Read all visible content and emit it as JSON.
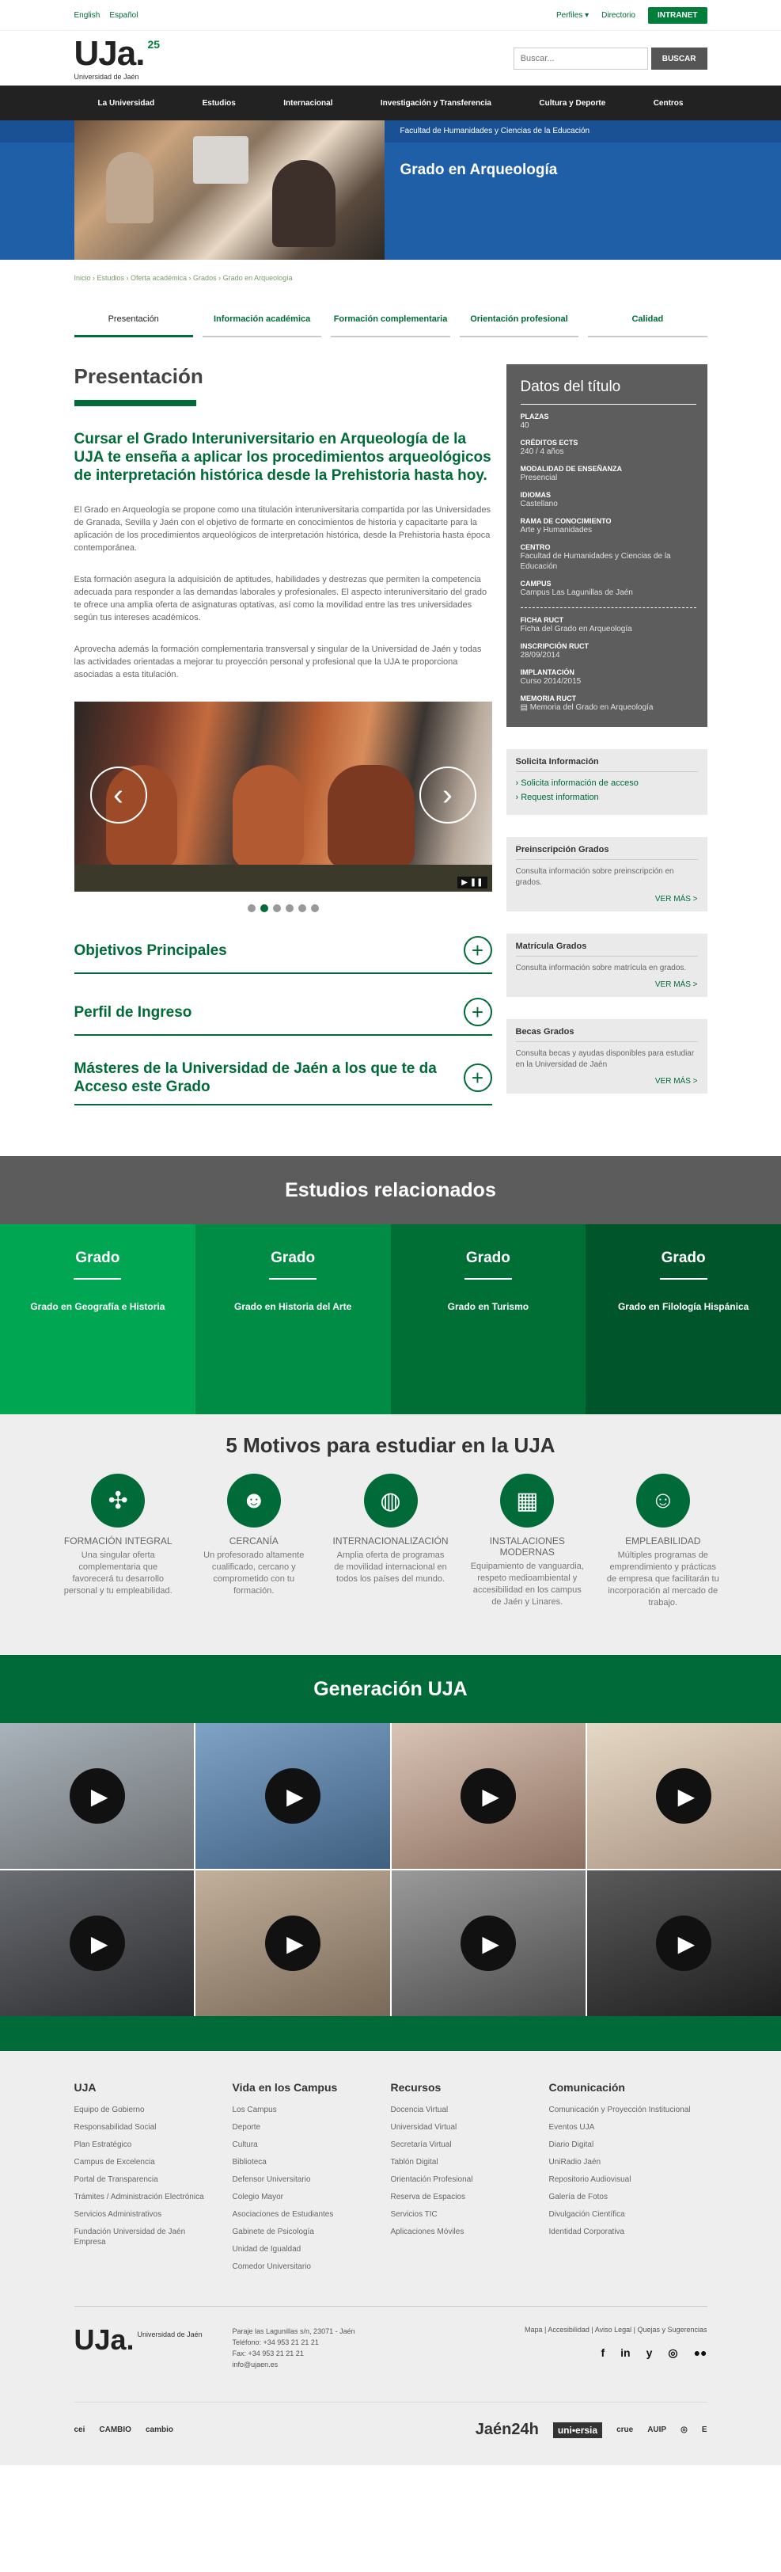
{
  "topbar": {
    "languages": [
      "English",
      "Español"
    ],
    "perfiles": "Perfiles",
    "directorio": "Directorio",
    "intranet": "INTRANET"
  },
  "header": {
    "logo_text": "UJa.",
    "logo_subtitle": "Universidad de Jaén",
    "logo_anniv": "25",
    "search_placeholder": "Buscar...",
    "search_button": "BUSCAR"
  },
  "nav": [
    "La Universidad",
    "Estudios",
    "Internacional",
    "Investigación y Transferencia",
    "Cultura y Deporte",
    "Centros"
  ],
  "hero": {
    "faculty": "Facultad de Humanidades y Ciencias de la Educación",
    "title": "Grado en Arqueología"
  },
  "breadcrumb": "Inicio › Estudios › Oferta académica › Grados › Grado en Arqueología",
  "tabs": [
    "Presentación",
    "Información académica",
    "Formación complementaria",
    "Orientación profesional",
    "Calidad"
  ],
  "content": {
    "heading": "Presentación",
    "lead": "Cursar el Grado Interuniversitario en Arqueología de la UJA te enseña a aplicar los procedimientos arqueológicos de interpretación histórica desde la Prehistoria hasta hoy.",
    "paragraphs": [
      "El Grado en Arqueología se propone como una titulación interuniversitaria compartida por las Universidades de Granada, Sevilla y Jaén con el objetivo de formarte en conocimientos de historia y capacitarte para la aplicación de los procedimientos arqueológicos de interpretación histórica, desde la Prehistoria hasta época contemporánea.",
      "Esta formación asegura la adquisición de aptitudes, habilidades y destrezas que permiten la competencia adecuada para responder a las demandas laborales y profesionales. El aspecto interuniversitario del grado te ofrece una amplia oferta de asignaturas optativas, así como la movilidad entre las tres universidades según tus intereses académicos.",
      "Aprovecha además la formación complementaria transversal y singular de la Universidad de Jaén y todas las actividades orientadas a mejorar tu proyección personal y profesional que la UJA te proporciona asociadas a esta titulación."
    ],
    "carousel_control": "▶ ❚❚",
    "accordion": [
      "Objetivos Principales",
      "Perfil de Ingreso",
      "Másteres de la Universidad de Jaén a los que te da Acceso este Grado"
    ]
  },
  "datos": {
    "title": "Datos del título",
    "items": [
      {
        "label": "PLAZAS",
        "value": "40"
      },
      {
        "label": "CRÉDITOS ECTS",
        "value": "240 / 4 años"
      },
      {
        "label": "MODALIDAD DE ENSEÑANZA",
        "value": "Presencial"
      },
      {
        "label": "IDIOMAS",
        "value": "Castellano"
      },
      {
        "label": "RAMA DE CONOCIMIENTO",
        "value": "Arte y Humanidades"
      },
      {
        "label": "CENTRO",
        "value": "Facultad de Humanidades y Ciencias de la Educación"
      },
      {
        "label": "CAMPUS",
        "value": "Campus Las Lagunillas de Jaén"
      }
    ],
    "items2": [
      {
        "label": "FICHA RUCT",
        "value": "Ficha del Grado en Arqueología"
      },
      {
        "label": "INSCRIPCIÓN RUCT",
        "value": "28/09/2014"
      },
      {
        "label": "IMPLANTACIÓN",
        "value": "Curso 2014/2015"
      },
      {
        "label": "MEMORIA RUCT",
        "value": "Memoria del Grado en Arqueología"
      }
    ]
  },
  "solicita": {
    "title": "Solicita Información",
    "links": [
      "Solicita información de acceso",
      "Request information"
    ]
  },
  "boxes": [
    {
      "title": "Preinscripción Grados",
      "text": "Consulta información sobre preinscripción en grados.",
      "more": "VER MÁS >"
    },
    {
      "title": "Matrícula Grados",
      "text": "Consulta información sobre matrícula en grados.",
      "more": "VER MÁS >"
    },
    {
      "title": "Becas Grados",
      "text": "Consulta becas y ayudas disponibles para estudiar en la Universidad de Jaén",
      "more": "VER MÁS >"
    }
  ],
  "related": {
    "title": "Estudios relacionados",
    "cards": [
      {
        "type": "Grado",
        "name": "Grado en Geografía e Historia",
        "color": "#00a651"
      },
      {
        "type": "Grado",
        "name": "Grado en Historia del Arte",
        "color": "#008c45"
      },
      {
        "type": "Grado",
        "name": "Grado en Turismo",
        "color": "#006f36"
      },
      {
        "type": "Grado",
        "name": "Grado en Filología Hispánica",
        "color": "#00552a"
      }
    ]
  },
  "motivos": {
    "title": "5 Motivos para estudiar en la UJA",
    "items": [
      {
        "icon": "compass-icon",
        "title": "FORMACIÓN INTEGRAL",
        "text": "Una singular oferta complementaria que favorecerá tu desarrollo personal y tu empleabilidad."
      },
      {
        "icon": "people-icon",
        "title": "CERCANÍA",
        "text": "Un profesorado altamente cualificado, cercano y comprometido con tu formación."
      },
      {
        "icon": "globe-icon",
        "title": "INTERNACIONALIZACIÓN",
        "text": "Amplia oferta de programas de movilidad internacional en todos los países del mundo."
      },
      {
        "icon": "building-icon",
        "title": "INSTALACIONES MODERNAS",
        "text": "Equipamiento de vanguardia, respeto medioambiental y accesibilidad en los campus de Jaén y Linares."
      },
      {
        "icon": "worker-icon",
        "title": "EMPLEABILIDAD",
        "text": "Múltiples programas de emprendimiento y prácticas de empresa que facilitarán tu incorporación al mercado de trabajo."
      }
    ]
  },
  "generacion": {
    "title": "Generación UJA",
    "videos": [
      {
        "bg": "#8a8f94"
      },
      {
        "bg": "#5c7fa0"
      },
      {
        "bg": "#b89c8c"
      },
      {
        "bg": "#c7b8a7"
      },
      {
        "bg": "#4a4d52"
      },
      {
        "bg": "#a08e7c"
      },
      {
        "bg": "#707070"
      },
      {
        "bg": "#3a3a3a"
      }
    ]
  },
  "footer": {
    "cols": [
      {
        "title": "UJA",
        "items": [
          "Equipo de Gobierno",
          "Responsabilidad Social",
          "Plan Estratégico",
          "Campus de Excelencia",
          "Portal de Transparencia",
          "Trámites / Administración Electrónica",
          "Servicios Administrativos",
          "Fundación Universidad de Jaén Empresa"
        ]
      },
      {
        "title": "Vida en los Campus",
        "items": [
          "Los Campus",
          "Deporte",
          "Cultura",
          "Biblioteca",
          "Defensor Universitario",
          "Colegio Mayor",
          "Asociaciones de Estudiantes",
          "Gabinete de Psicología",
          "Unidad de Igualdad",
          "Comedor Universitario"
        ]
      },
      {
        "title": "Recursos",
        "items": [
          "Docencia Virtual",
          "Universidad Virtual",
          "Secretaría Virtual",
          "Tablón Digital",
          "Orientación Profesional",
          "Reserva de Espacios",
          "Servicios TIC",
          "Aplicaciones Móviles"
        ]
      },
      {
        "title": "Comunicación",
        "items": [
          "Comunicación y Proyección Institucional",
          "Eventos UJA",
          "Diario Digital",
          "UniRadio Jaén",
          "Repositorio Audiovisual",
          "Galería de Fotos",
          "Divulgación Científica",
          "Identidad Corporativa"
        ]
      }
    ],
    "logo": "UJa.",
    "logo_sub": "Universidad de Jaén",
    "address": [
      "Paraje las Lagunillas s/n, 23071 - Jaén",
      "Teléfono: +34 953 21 21 21",
      "Fax: +34 953 21 21 21",
      "info@ujaen.es"
    ],
    "legal": "Mapa | Accesibilidad | Aviso Legal | Quejas y Sugerencias",
    "social": [
      "f",
      "in",
      "y",
      "◎",
      "●●"
    ],
    "partners_left": [
      "cei",
      "CAMBIO",
      "cambio"
    ],
    "partners_right": [
      "Jaén24h",
      "uni•ersia",
      "crue",
      "AUIP",
      "◎",
      "E"
    ]
  }
}
